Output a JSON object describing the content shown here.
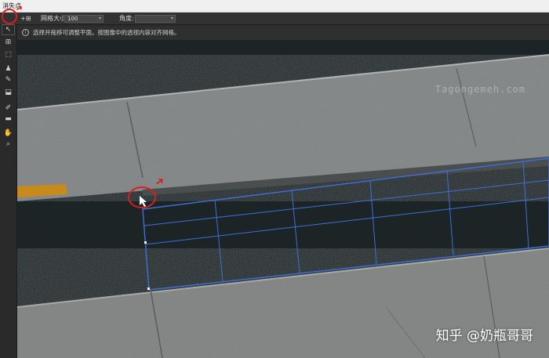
{
  "window": {
    "title": "消失点"
  },
  "options": {
    "mode_label": "+⊞",
    "grid_size_label": "网格大小:",
    "grid_size_value": "100",
    "angle_label": "角度:",
    "angle_value": ""
  },
  "info": {
    "icon": "info-icon",
    "message": "选择并拖移可调整平面。按图像中的透视内容对齐网格。"
  },
  "toolbar": {
    "tools": [
      {
        "name": "edit-plane-tool",
        "icon": "arrow-pointer-icon",
        "glyph": "↖"
      },
      {
        "name": "create-plane-tool",
        "icon": "create-plane-icon",
        "glyph": "⊞"
      },
      {
        "name": "marquee-tool",
        "icon": "marquee-icon",
        "glyph": "⬚"
      },
      {
        "name": "stamp-tool",
        "icon": "stamp-icon",
        "glyph": "♟"
      },
      {
        "name": "brush-tool",
        "icon": "brush-icon",
        "glyph": "✎"
      },
      {
        "name": "transform-tool",
        "icon": "transform-icon",
        "glyph": "⬓"
      },
      {
        "name": "eyedropper-tool",
        "icon": "eyedropper-icon",
        "glyph": "✐"
      },
      {
        "name": "measure-tool",
        "icon": "ruler-icon",
        "glyph": "▬"
      },
      {
        "name": "hand-tool",
        "icon": "hand-icon",
        "glyph": "✋"
      },
      {
        "name": "zoom-tool",
        "icon": "zoom-icon",
        "glyph": "⌕"
      }
    ]
  },
  "canvas": {
    "watermark": "Tagongemeh.com",
    "credit": "知乎 @奶瓶哥哥"
  },
  "colors": {
    "grid": "#3f6fd8",
    "highlight": "#d61f1f",
    "road": "#1c2426",
    "pavement": "#8c8f8f"
  }
}
